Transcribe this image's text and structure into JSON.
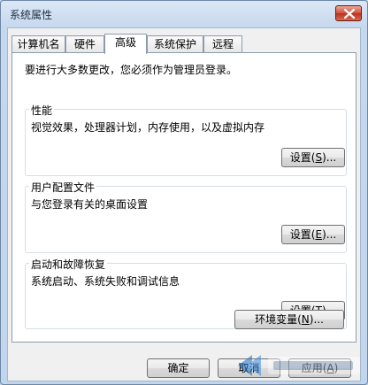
{
  "window": {
    "title": "系统属性"
  },
  "tabs": [
    {
      "label": "计算机名"
    },
    {
      "label": "硬件"
    },
    {
      "label": "高级"
    },
    {
      "label": "系统保护"
    },
    {
      "label": "远程"
    }
  ],
  "active_tab": "高级",
  "panel": {
    "intro": "要进行大多数更改，您必须作为管理员登录。",
    "performance": {
      "legend": "性能",
      "desc": "视觉效果，处理器计划，内存使用，以及虚拟内存",
      "button": {
        "text": "设置",
        "key": "S",
        "suffix": "..."
      }
    },
    "profile": {
      "legend": "用户配置文件",
      "desc": "与您登录有关的桌面设置",
      "button": {
        "text": "设置",
        "key": "E",
        "suffix": "..."
      }
    },
    "startup": {
      "legend": "启动和故障恢复",
      "desc": "系统启动、系统失败和调试信息",
      "button": {
        "text": "设置",
        "key": "T",
        "suffix": "..."
      }
    },
    "env_button": {
      "text": "环境变量",
      "key": "N",
      "suffix": "..."
    }
  },
  "footer": {
    "ok": "确定",
    "cancel": "取消",
    "apply": "应用",
    "apply_key": "A"
  }
}
